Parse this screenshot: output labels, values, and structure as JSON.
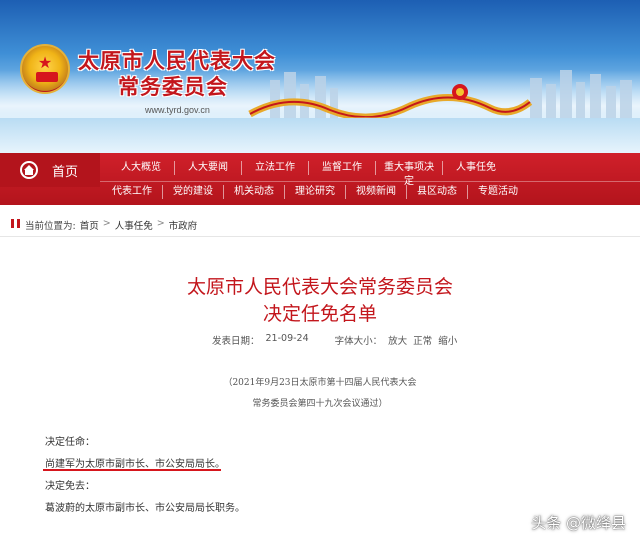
{
  "site": {
    "title_line1": "太原市人民代表大会",
    "title_line2": "常务委员会",
    "url": "www.tyrd.gov.cn"
  },
  "nav": {
    "home": "首页",
    "row1": [
      "人大概览",
      "人大要闻",
      "立法工作",
      "监督工作",
      "重大事项决定",
      "人事任免"
    ],
    "row2": [
      "代表工作",
      "党的建设",
      "机关动态",
      "理论研究",
      "视频新闻",
      "县区动态",
      "专题活动"
    ]
  },
  "breadcrumb": {
    "prefix": "当前位置为:",
    "items": [
      "首页",
      "人事任免",
      "市政府"
    ],
    "separator": ">"
  },
  "article": {
    "title_line1": "太原市人民代表大会常务委员会",
    "title_line2": "决定任免名单",
    "date_label": "发表日期：",
    "date": "21-09-24",
    "font_label": "字体大小：",
    "font_options": [
      "放大",
      "正常",
      "缩小"
    ],
    "note_line1": "（2021年9月23日太原市第十四届人民代表大会",
    "note_line2": "常务委员会第四十九次会议通过）",
    "appoint_label": "决定任命：",
    "appoint_text": "尚建军为太原市副市长、市公安局局长。",
    "remove_label": "决定免去：",
    "remove_text": "葛波蔚的太原市副市长、市公安局局长职务。"
  },
  "watermark": "头条 @微绛县",
  "colors": {
    "brand_red": "#c3161c",
    "nav_red": "#d0202a"
  }
}
